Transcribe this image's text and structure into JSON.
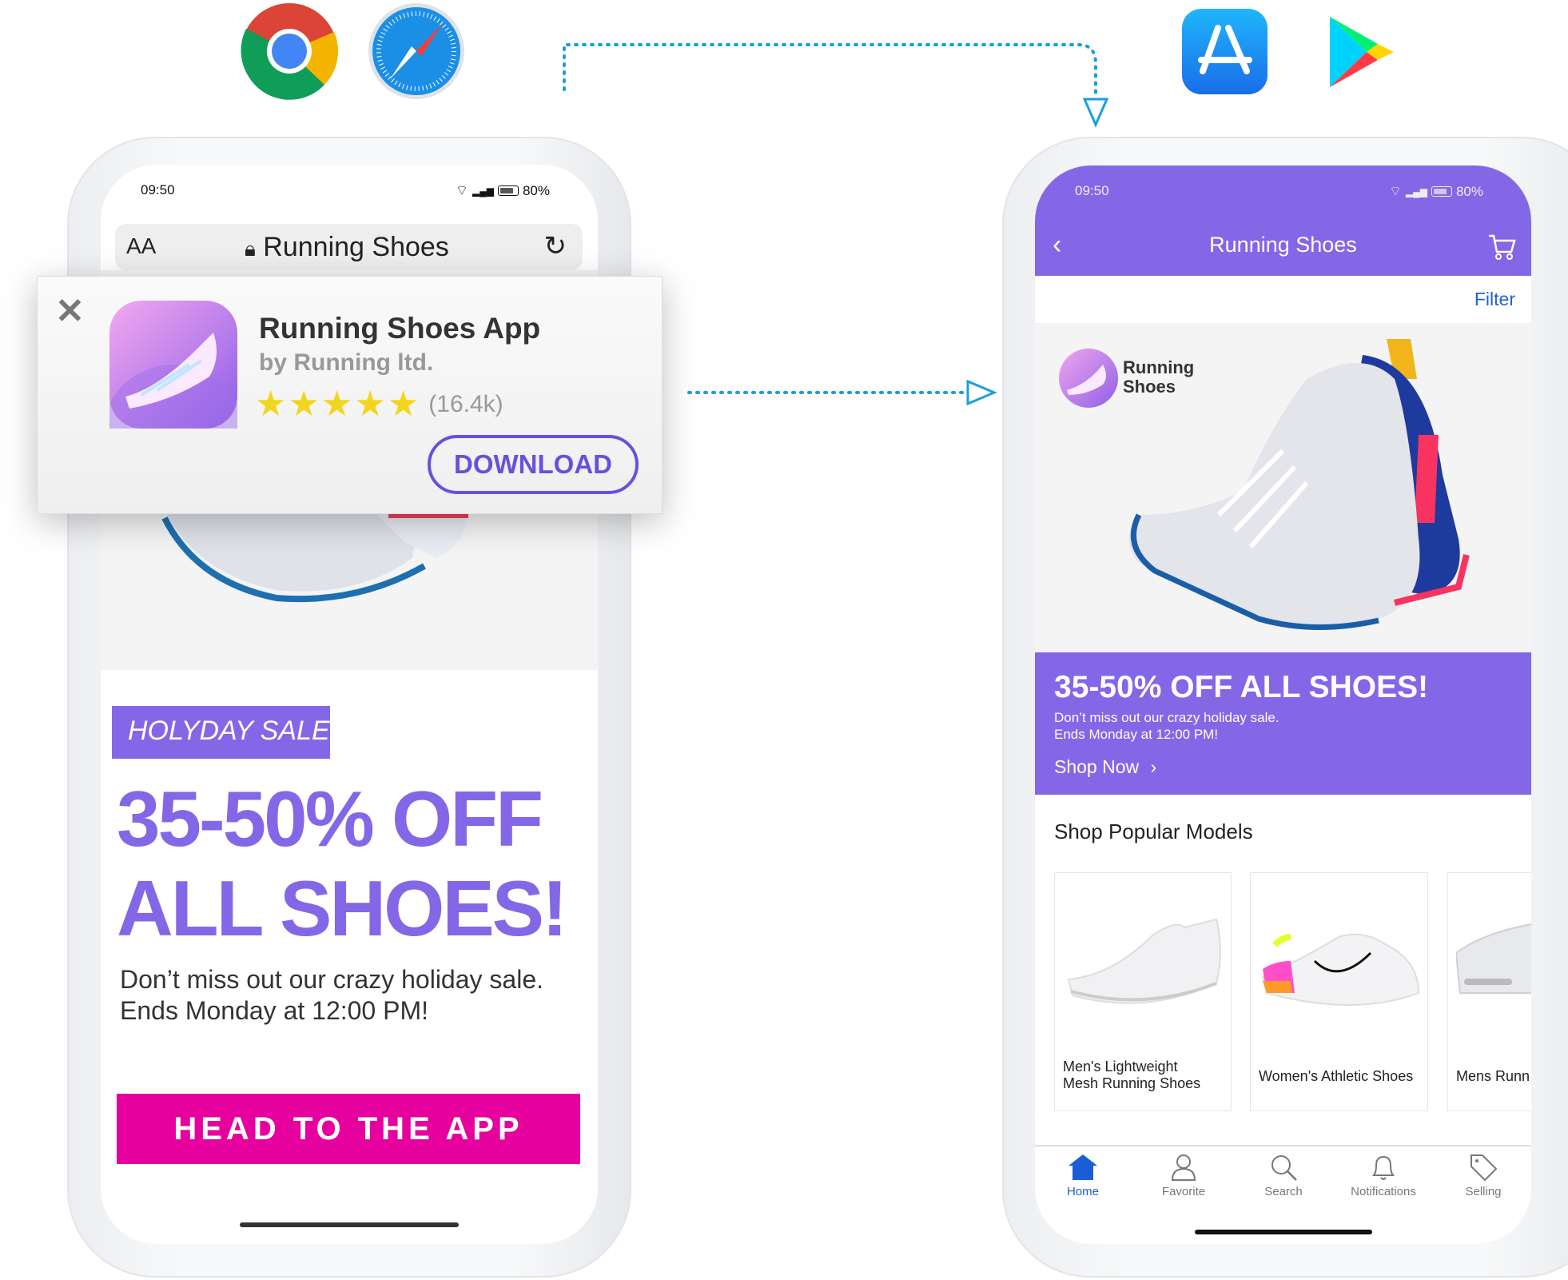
{
  "top_icons": {
    "browsers": [
      "chrome-icon",
      "safari-icon"
    ],
    "stores": [
      "app-store-icon",
      "google-play-icon"
    ]
  },
  "left_phone": {
    "status": {
      "time": "09:50",
      "battery": "80%"
    },
    "url_bar": {
      "text_size": "AA",
      "title": "Running Shoes"
    },
    "smart_banner": {
      "app_name": "Running Shoes App",
      "developer": "by Running ltd.",
      "rating_stars": 5,
      "rating_count": "(16.4k)",
      "download_label": "DOWNLOAD"
    },
    "sale_badge": "HOLYDAY SALE",
    "headline_line1": "35-50% OFF",
    "headline_line2": "ALL SHOES!",
    "description_line1": "Don’t miss out our crazy holiday sale.",
    "description_line2": "Ends Monday at 12:00 PM!",
    "cta_label": "HEAD TO THE APP"
  },
  "right_phone": {
    "status": {
      "time": "09:50",
      "battery": "80%"
    },
    "header": {
      "title": "Running Shoes"
    },
    "filter_label": "Filter",
    "brand": {
      "line1": "Running",
      "line2": "Shoes"
    },
    "promo": {
      "headline": "35-50% OFF ALL SHOES!",
      "line1": "Don’t miss out our crazy holiday sale.",
      "line2": "Ends Monday at 12:00 PM!",
      "link": "Shop Now"
    },
    "section_title": "Shop Popular Models",
    "products": [
      {
        "name_line1": "Men's Lightweight",
        "name_line2": "Mesh Running Shoes"
      },
      {
        "name_line1": "Women's Athletic Shoes",
        "name_line2": ""
      },
      {
        "name_line1": "Mens Runn",
        "name_line2": ""
      }
    ],
    "bottom_nav": [
      {
        "label": "Home",
        "icon": "home-icon",
        "active": true
      },
      {
        "label": "Favorite",
        "icon": "user-icon"
      },
      {
        "label": "Search",
        "icon": "search-icon"
      },
      {
        "label": "Notifications",
        "icon": "bell-icon"
      },
      {
        "label": "Selling",
        "icon": "tag-icon"
      }
    ]
  },
  "colors": {
    "purple": "#8467e6",
    "cta_magenta": "#e6009e",
    "nav_active": "#1a5ed6",
    "filter_blue": "#1f63c9",
    "star": "#f2d51e"
  }
}
